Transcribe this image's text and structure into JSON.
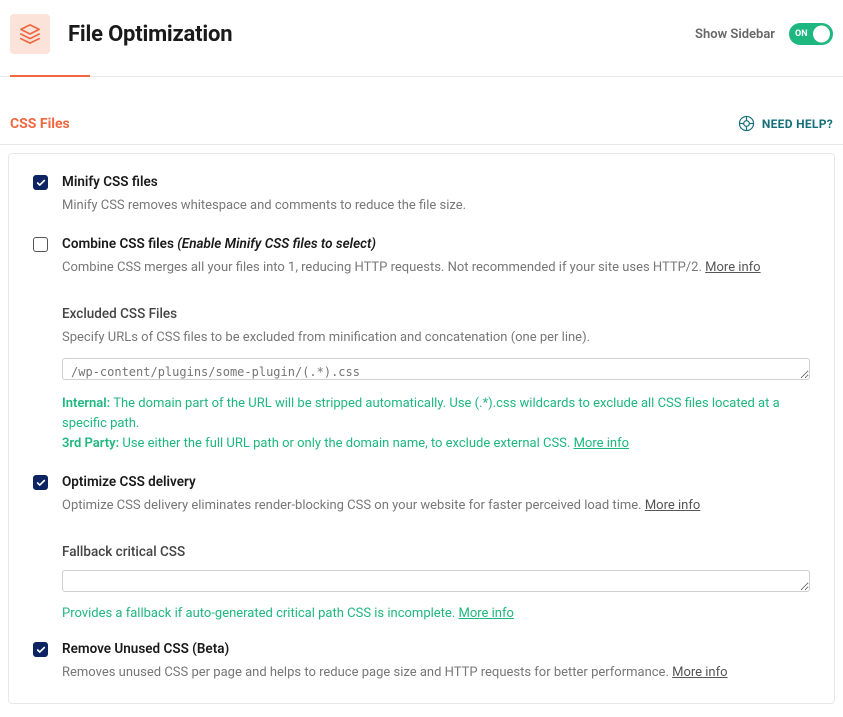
{
  "header": {
    "title": "File Optimization",
    "sidebar_label": "Show Sidebar",
    "toggle_state": "ON"
  },
  "section": {
    "title": "CSS Files",
    "help_label": "NEED HELP?"
  },
  "options": {
    "minify": {
      "title": "Minify CSS files",
      "desc": "Minify CSS removes whitespace and comments to reduce the file size."
    },
    "combine": {
      "title": "Combine CSS files",
      "note": "(Enable Minify CSS files to select)",
      "desc": "Combine CSS merges all your files into 1, reducing HTTP requests. Not recommended if your site uses HTTP/2.",
      "more_info": "More info"
    },
    "excluded": {
      "title": "Excluded CSS Files",
      "desc": "Specify URLs of CSS files to be excluded from minification and concatenation (one per line).",
      "placeholder": "/wp-content/plugins/some-plugin/(.*).css",
      "internal_label": "Internal:",
      "internal_text": "The domain part of the URL will be stripped automatically. Use (.*).css wildcards to exclude all CSS files located at a specific path.",
      "third_label": "3rd Party:",
      "third_text": "Use either the full URL path or only the domain name, to exclude external CSS.",
      "more_info": "More info"
    },
    "optimize": {
      "title": "Optimize CSS delivery",
      "desc": "Optimize CSS delivery eliminates render-blocking CSS on your website for faster perceived load time.",
      "more_info": "More info"
    },
    "fallback": {
      "title": "Fallback critical CSS",
      "hint": "Provides a fallback if auto-generated critical path CSS is incomplete.",
      "more_info": "More info"
    },
    "remove_unused": {
      "title": "Remove Unused CSS (Beta)",
      "desc": "Removes unused CSS per page and helps to reduce page size and HTTP requests for better performance.",
      "more_info": "More info"
    }
  }
}
